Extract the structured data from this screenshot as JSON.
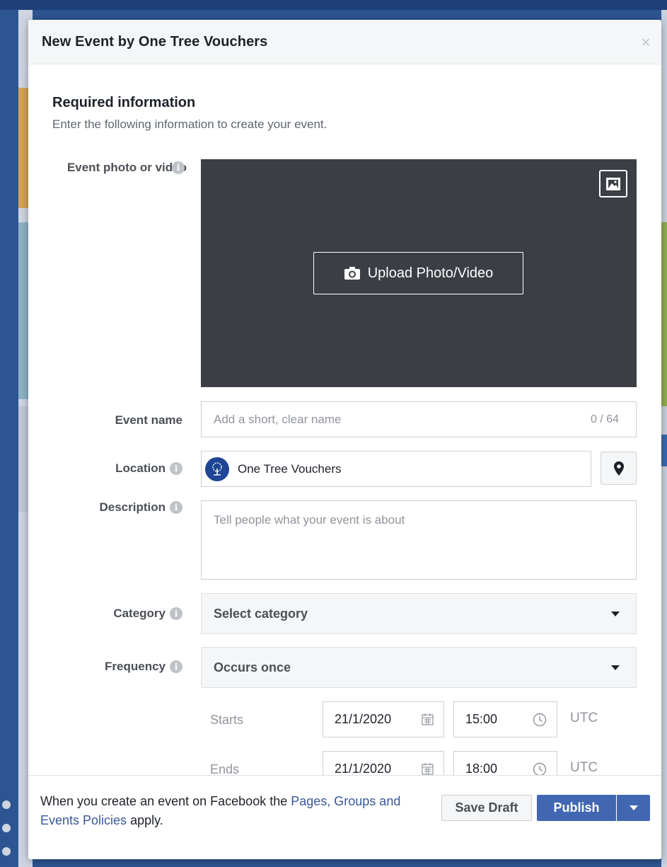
{
  "modal": {
    "title": "New Event by One Tree Vouchers",
    "close_label": "×"
  },
  "required": {
    "title": "Required information",
    "subtitle": "Enter the following information to create your event."
  },
  "photo": {
    "label": "Event photo or video",
    "upload_label": "Upload Photo/Video"
  },
  "event_name": {
    "label": "Event name",
    "placeholder": "Add a short, clear name",
    "counter": "0 / 64"
  },
  "location": {
    "label": "Location",
    "value": "One Tree Vouchers"
  },
  "description": {
    "label": "Description",
    "placeholder": "Tell people what your event is about"
  },
  "category": {
    "label": "Category",
    "value": "Select category"
  },
  "frequency": {
    "label": "Frequency",
    "value": "Occurs once"
  },
  "schedule": {
    "starts_label": "Starts",
    "start_date": "21/1/2020",
    "start_time": "15:00",
    "start_tz": "UTC",
    "ends_label": "Ends",
    "end_date": "21/1/2020",
    "end_time": "18:00",
    "end_tz": "UTC"
  },
  "footer": {
    "text_before": "When you create an event on Facebook the ",
    "link": "Pages, Groups and Events Policies",
    "text_after": " apply.",
    "save_draft": "Save Draft",
    "publish": "Publish"
  },
  "colors": {
    "primary": "#4267b2",
    "link": "#385898",
    "photo_bg": "#3b3e44"
  }
}
